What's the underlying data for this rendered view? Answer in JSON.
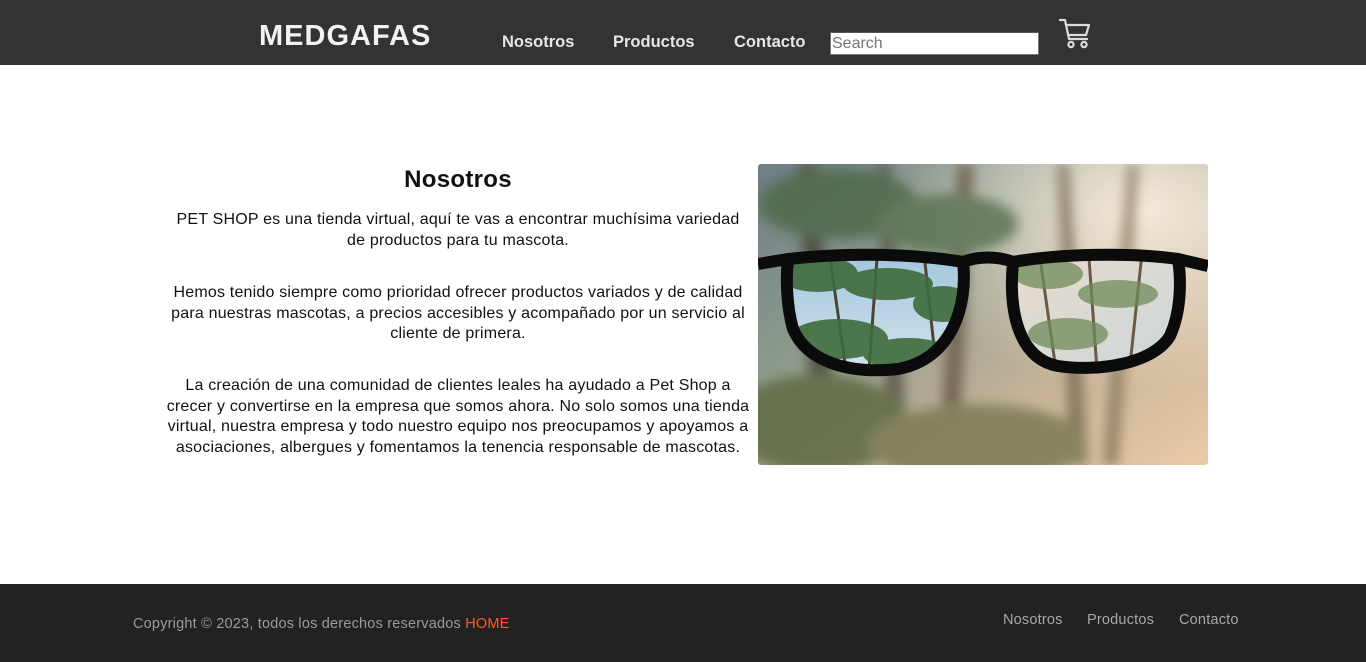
{
  "header": {
    "brand": "MEDGAFAS",
    "nav": [
      "Nosotros",
      "Productos",
      "Contacto"
    ],
    "search_placeholder": "Search",
    "search_value": "",
    "cart_icon": "shopping-cart-icon"
  },
  "main": {
    "title": "Nosotros",
    "paragraphs": [
      "PET SHOP es una tienda virtual, aquí te vas a encontrar muchísima variedad de productos para tu mascota.",
      "Hemos tenido siempre como prioridad ofrecer productos variados y de calidad para nuestras mascotas, a precios accesibles y acompañado por un servicio al cliente de primera.",
      "La creación de una comunidad de clientes leales ha ayudado a Pet Shop a crecer y convertirse en la empresa que somos ahora. No solo somos una tienda virtual, nuestra empresa y todo nuestro equipo nos preocupamos y apoyamos a asociaciones, albergues y fomentamos la tenencia responsable de mascotas."
    ],
    "image": "glasses-over-forest-image"
  },
  "footer": {
    "copyright": "Copyright © 2023, todos los derechos reservados ",
    "home_link": "HOME",
    "links": [
      "Nosotros",
      "Productos",
      "Contacto"
    ]
  },
  "colors": {
    "header_bg": "#333333",
    "footer_bg": "#222222",
    "accent": "#ff5a1f"
  }
}
